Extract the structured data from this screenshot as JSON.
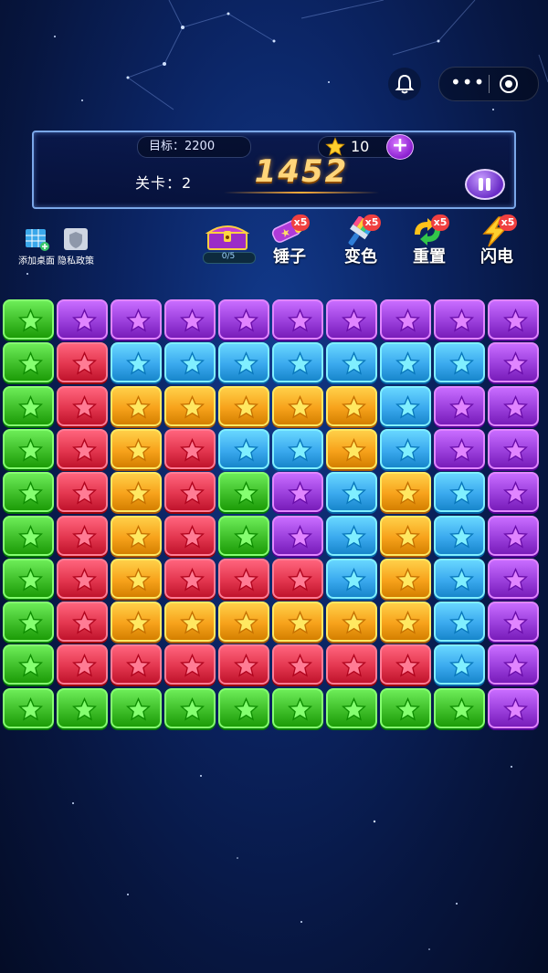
{
  "capsule": {
    "more_icon": "more-icon",
    "record_icon": "record-icon"
  },
  "header": {
    "target_label": "目标：2200",
    "coins": "10",
    "plus_label": "+",
    "level_label": "关卡：2",
    "score": "1452"
  },
  "quick": [
    {
      "label": "添加桌面",
      "icon": "add-desktop-icon"
    },
    {
      "label": "隐私政策",
      "icon": "privacy-shield-icon"
    }
  ],
  "chest": {
    "progress": "0/5",
    "progress_value": 0
  },
  "tools": [
    {
      "label": "锤子",
      "count": "x5",
      "icon": "hammer-icon"
    },
    {
      "label": "变色",
      "count": "x5",
      "icon": "paint-brush-icon"
    },
    {
      "label": "重置",
      "count": "x5",
      "icon": "reset-icon"
    },
    {
      "label": "闪电",
      "count": "x5",
      "icon": "lightning-icon"
    }
  ],
  "colors": {
    "G": "#3fbf2a",
    "P": "#9b3fdc",
    "R": "#e3364f",
    "B": "#3aa9ee",
    "O": "#f7a21b"
  },
  "board": [
    "GPPPPPPPPP",
    "GRBBBBBBBP",
    "GRO OOOOBP",
    "GRORBBOBP",
    "GRORGPBOBP",
    "GRORGPBOBP",
    "GRORRRBOBP",
    "GROOOOOOBP",
    "GRRRRRRRBP",
    "GGGGGGGGGP"
  ]
}
